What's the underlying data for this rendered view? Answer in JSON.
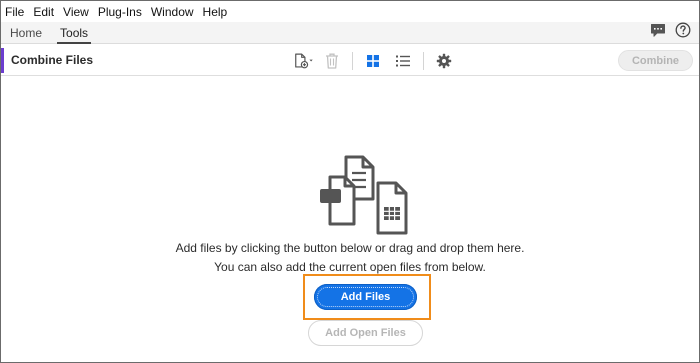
{
  "menubar": {
    "items": [
      {
        "label": "File"
      },
      {
        "label": "Edit"
      },
      {
        "label": "View"
      },
      {
        "label": "Plug-Ins"
      },
      {
        "label": "Window"
      },
      {
        "label": "Help"
      }
    ]
  },
  "tabs": {
    "items": [
      {
        "label": "Home",
        "active": false
      },
      {
        "label": "Tools",
        "active": true
      }
    ],
    "right_icons": [
      "comment-icon",
      "help-icon"
    ]
  },
  "toolbar": {
    "title": "Combine Files",
    "accent_color": "#6c3ecf",
    "icons": [
      "add-file-dropdown-icon",
      "trash-icon",
      "grid-view-icon",
      "list-view-icon",
      "gear-icon"
    ],
    "combine_label": "Combine"
  },
  "main": {
    "illustration_icon": "combine-documents-icon",
    "message_line1": "Add files by clicking the button below or drag and drop them here.",
    "message_line2": "You can also add the current open files from below.",
    "add_files_label": "Add Files",
    "add_open_files_label": "Add Open Files",
    "primary_color": "#1473e6",
    "highlight_color": "#f08c1a"
  }
}
